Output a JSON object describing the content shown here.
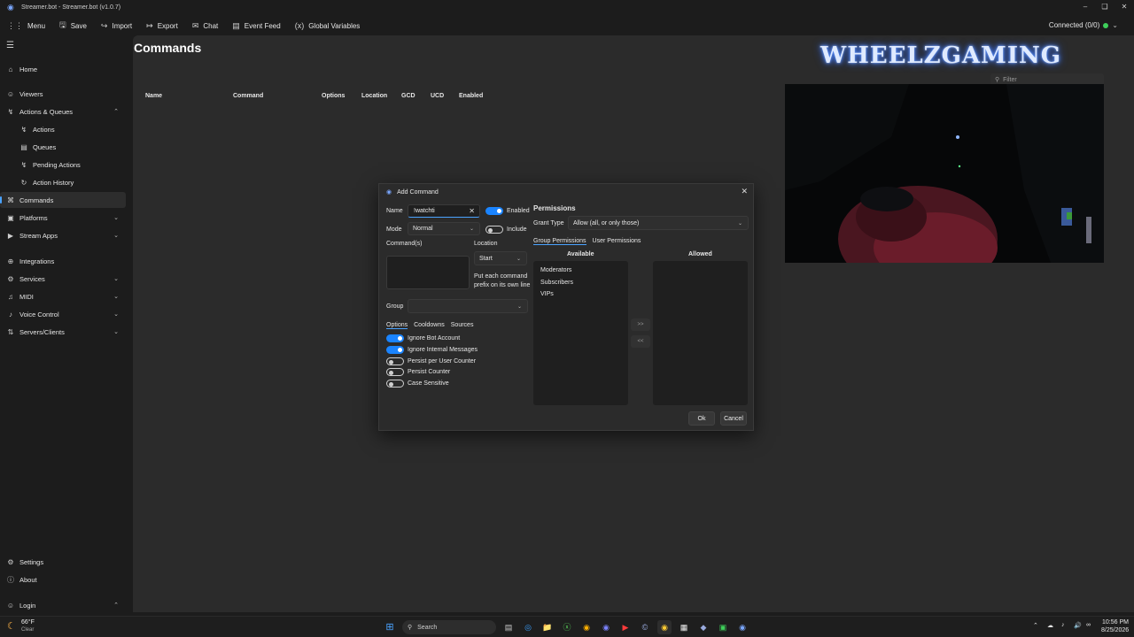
{
  "window": {
    "title": "Streamer.bot - Streamer.bot (v1.0.7)"
  },
  "menubar": {
    "items": [
      {
        "label": "Menu",
        "icon": "grid-icon"
      },
      {
        "label": "Save",
        "icon": "save-icon"
      },
      {
        "label": "Import",
        "icon": "import-icon"
      },
      {
        "label": "Export",
        "icon": "export-icon"
      },
      {
        "label": "Chat",
        "icon": "chat-icon"
      },
      {
        "label": "Event Feed",
        "icon": "event-feed-icon"
      },
      {
        "label": "Global Variables",
        "icon": "variables-icon"
      }
    ],
    "connection": "Connected (0/0)",
    "connection_color": "#3ecf5a"
  },
  "sidebar": {
    "items": [
      {
        "label": "Home",
        "icon": "home-icon"
      },
      {
        "label": "Viewers",
        "icon": "user-icon"
      },
      {
        "label": "Actions & Queues",
        "icon": "lightning-icon"
      },
      {
        "label": "Actions",
        "icon": "lightning-icon"
      },
      {
        "label": "Queues",
        "icon": "queue-icon"
      },
      {
        "label": "Pending Actions",
        "icon": "pending-icon"
      },
      {
        "label": "Action History",
        "icon": "history-icon"
      },
      {
        "label": "Commands",
        "icon": "commands-icon"
      },
      {
        "label": "Platforms",
        "icon": "platforms-icon"
      },
      {
        "label": "Stream Apps",
        "icon": "stream-apps-icon"
      },
      {
        "label": "Integrations",
        "icon": "integrations-icon"
      },
      {
        "label": "Services",
        "icon": "services-icon"
      },
      {
        "label": "MIDI",
        "icon": "midi-icon"
      },
      {
        "label": "Voice Control",
        "icon": "microphone-icon"
      },
      {
        "label": "Servers/Clients",
        "icon": "servers-icon"
      }
    ],
    "bottom": [
      {
        "label": "Settings",
        "icon": "gear-icon"
      },
      {
        "label": "About",
        "icon": "info-icon"
      },
      {
        "label": "Login",
        "icon": "login-icon"
      }
    ]
  },
  "main": {
    "title": "Commands",
    "columns": [
      "Name",
      "Command",
      "Options",
      "Location",
      "GCD",
      "UCD",
      "Enabled"
    ],
    "filter_placeholder": "Filter"
  },
  "overlay": {
    "banner": "WHEELZGAMING"
  },
  "dialog": {
    "title": "Add Command",
    "name_label": "Name",
    "name_value": "!watchti",
    "enabled_label": "Enabled",
    "enabled": true,
    "mode_label": "Mode",
    "mode_value": "Normal",
    "include_label": "Include",
    "include": false,
    "commands_label": "Command(s)",
    "location_label": "Location",
    "location_value": "Start",
    "hint": "Put each command prefix on its own line",
    "group_label": "Group",
    "option_tabs": [
      "Options",
      "Cooldowns",
      "Sources"
    ],
    "options": [
      {
        "label": "Ignore Bot Account",
        "on": true
      },
      {
        "label": "Ignore Internal Messages",
        "on": true
      },
      {
        "label": "Persist per User Counter",
        "on": false
      },
      {
        "label": "Persist Counter",
        "on": false
      },
      {
        "label": "Case Sensitive",
        "on": false
      }
    ],
    "permissions_title": "Permissions",
    "grant_type_label": "Grant Type",
    "grant_type_value": "Allow (all, or only those)",
    "perm_tabs": [
      "Group Permissions",
      "User Permissions"
    ],
    "available_header": "Available",
    "allowed_header": "Allowed",
    "available": [
      "Moderators",
      "Subscribers",
      "VIPs"
    ],
    "add_btn": ">>",
    "remove_btn": "<<",
    "ok": "Ok",
    "cancel": "Cancel"
  },
  "taskbar": {
    "weather_temp": "66°F",
    "weather_desc": "Clear",
    "search_placeholder": "Search",
    "time": "10:56 PM",
    "date": "8/25/2026"
  }
}
